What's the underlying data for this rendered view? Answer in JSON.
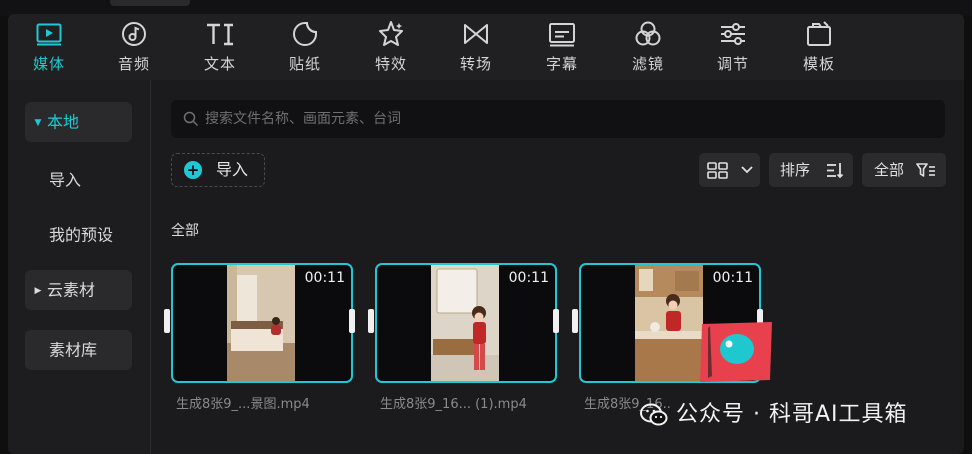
{
  "toolbar": {
    "items": [
      {
        "label": "媒体",
        "icon": "media-play-icon",
        "active": true
      },
      {
        "label": "音频",
        "icon": "audio-note-icon"
      },
      {
        "label": "文本",
        "icon": "text-ti-icon"
      },
      {
        "label": "贴纸",
        "icon": "sticker-icon"
      },
      {
        "label": "特效",
        "icon": "effects-star-icon"
      },
      {
        "label": "转场",
        "icon": "transition-bowtie-icon"
      },
      {
        "label": "字幕",
        "icon": "subtitle-icon"
      },
      {
        "label": "滤镜",
        "icon": "filter-circles-icon"
      },
      {
        "label": "调节",
        "icon": "adjust-sliders-icon"
      },
      {
        "label": "模板",
        "icon": "template-icon"
      }
    ]
  },
  "sidebar": {
    "items": [
      {
        "label": "本地",
        "expandable": true,
        "active": true
      },
      {
        "label": "导入"
      },
      {
        "label": "我的预设"
      },
      {
        "label": "云素材",
        "expandable": true
      },
      {
        "label": "素材库"
      }
    ]
  },
  "search": {
    "placeholder": "搜索文件名称、画面元素、台词"
  },
  "import_button": {
    "label": "导入"
  },
  "controls": {
    "sort_label": "排序",
    "filter_label": "全部"
  },
  "section_label": "全部",
  "media": [
    {
      "duration": "00:11",
      "filename": "生成8张9_...景图.mp4",
      "scene": "bedroom"
    },
    {
      "duration": "00:11",
      "filename": "生成8张9_16... (1).mp4",
      "scene": "bathroom"
    },
    {
      "duration": "00:11",
      "filename": "生成8张9_16..",
      "scene": "kitchen"
    }
  ],
  "watermark": "公众号 · 科哥AI工具箱",
  "colors": {
    "accent": "#21c8d4",
    "panel": "#1b1b1d",
    "toolbar": "#202022",
    "sticker": "#e8414d"
  }
}
